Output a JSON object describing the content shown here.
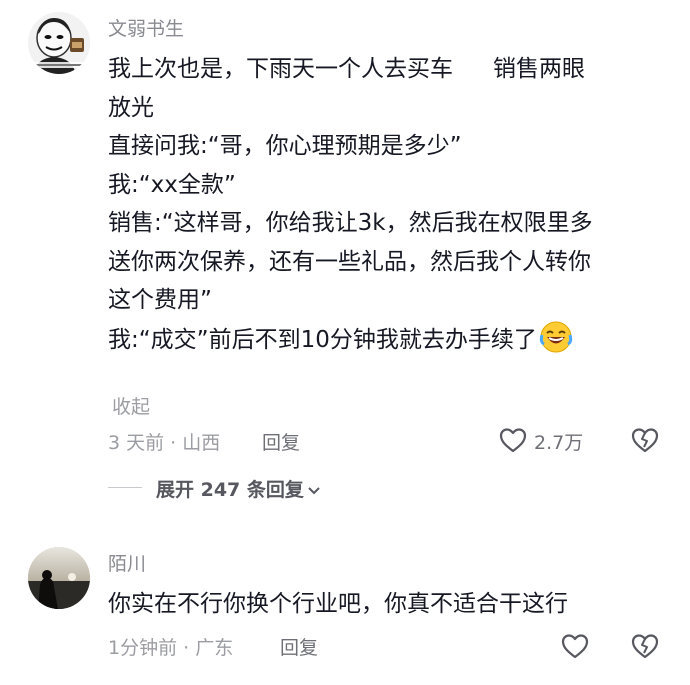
{
  "comments": [
    {
      "username": "文弱书生",
      "lines": [
        "我上次也是，下雨天一个人去买车",
        "销售两眼",
        "放光",
        "直接问我:“哥，你心理预期是多少”",
        "我:“xx全款”",
        "销售:“这样哥，你给我让3k，然后我在权限里多",
        "送你两次保养，还有一些礼品，然后我个人转你",
        "这个费用”",
        "我:“成交”前后不到10分钟我就去办手续了"
      ],
      "collapse_label": "收起",
      "time_location": "3 天前 · 山西",
      "reply_label": "回复",
      "like_count": "2.7万",
      "expand_replies_label": "展开 247 条回复"
    },
    {
      "username": "陌川",
      "text": "你实在不行你换个行业吧，你真不适合干这行",
      "time_location": "1分钟前 · 广东",
      "reply_label": "回复"
    }
  ],
  "icons": [
    "avatar-meme-face",
    "avatar-sunset-photo",
    "laughing-emoji",
    "heart-icon",
    "broken-heart-icon",
    "chevron-down-icon"
  ],
  "colors": {
    "text": "#161823",
    "secondary": "#9c9da3",
    "username": "#8a8b91"
  }
}
